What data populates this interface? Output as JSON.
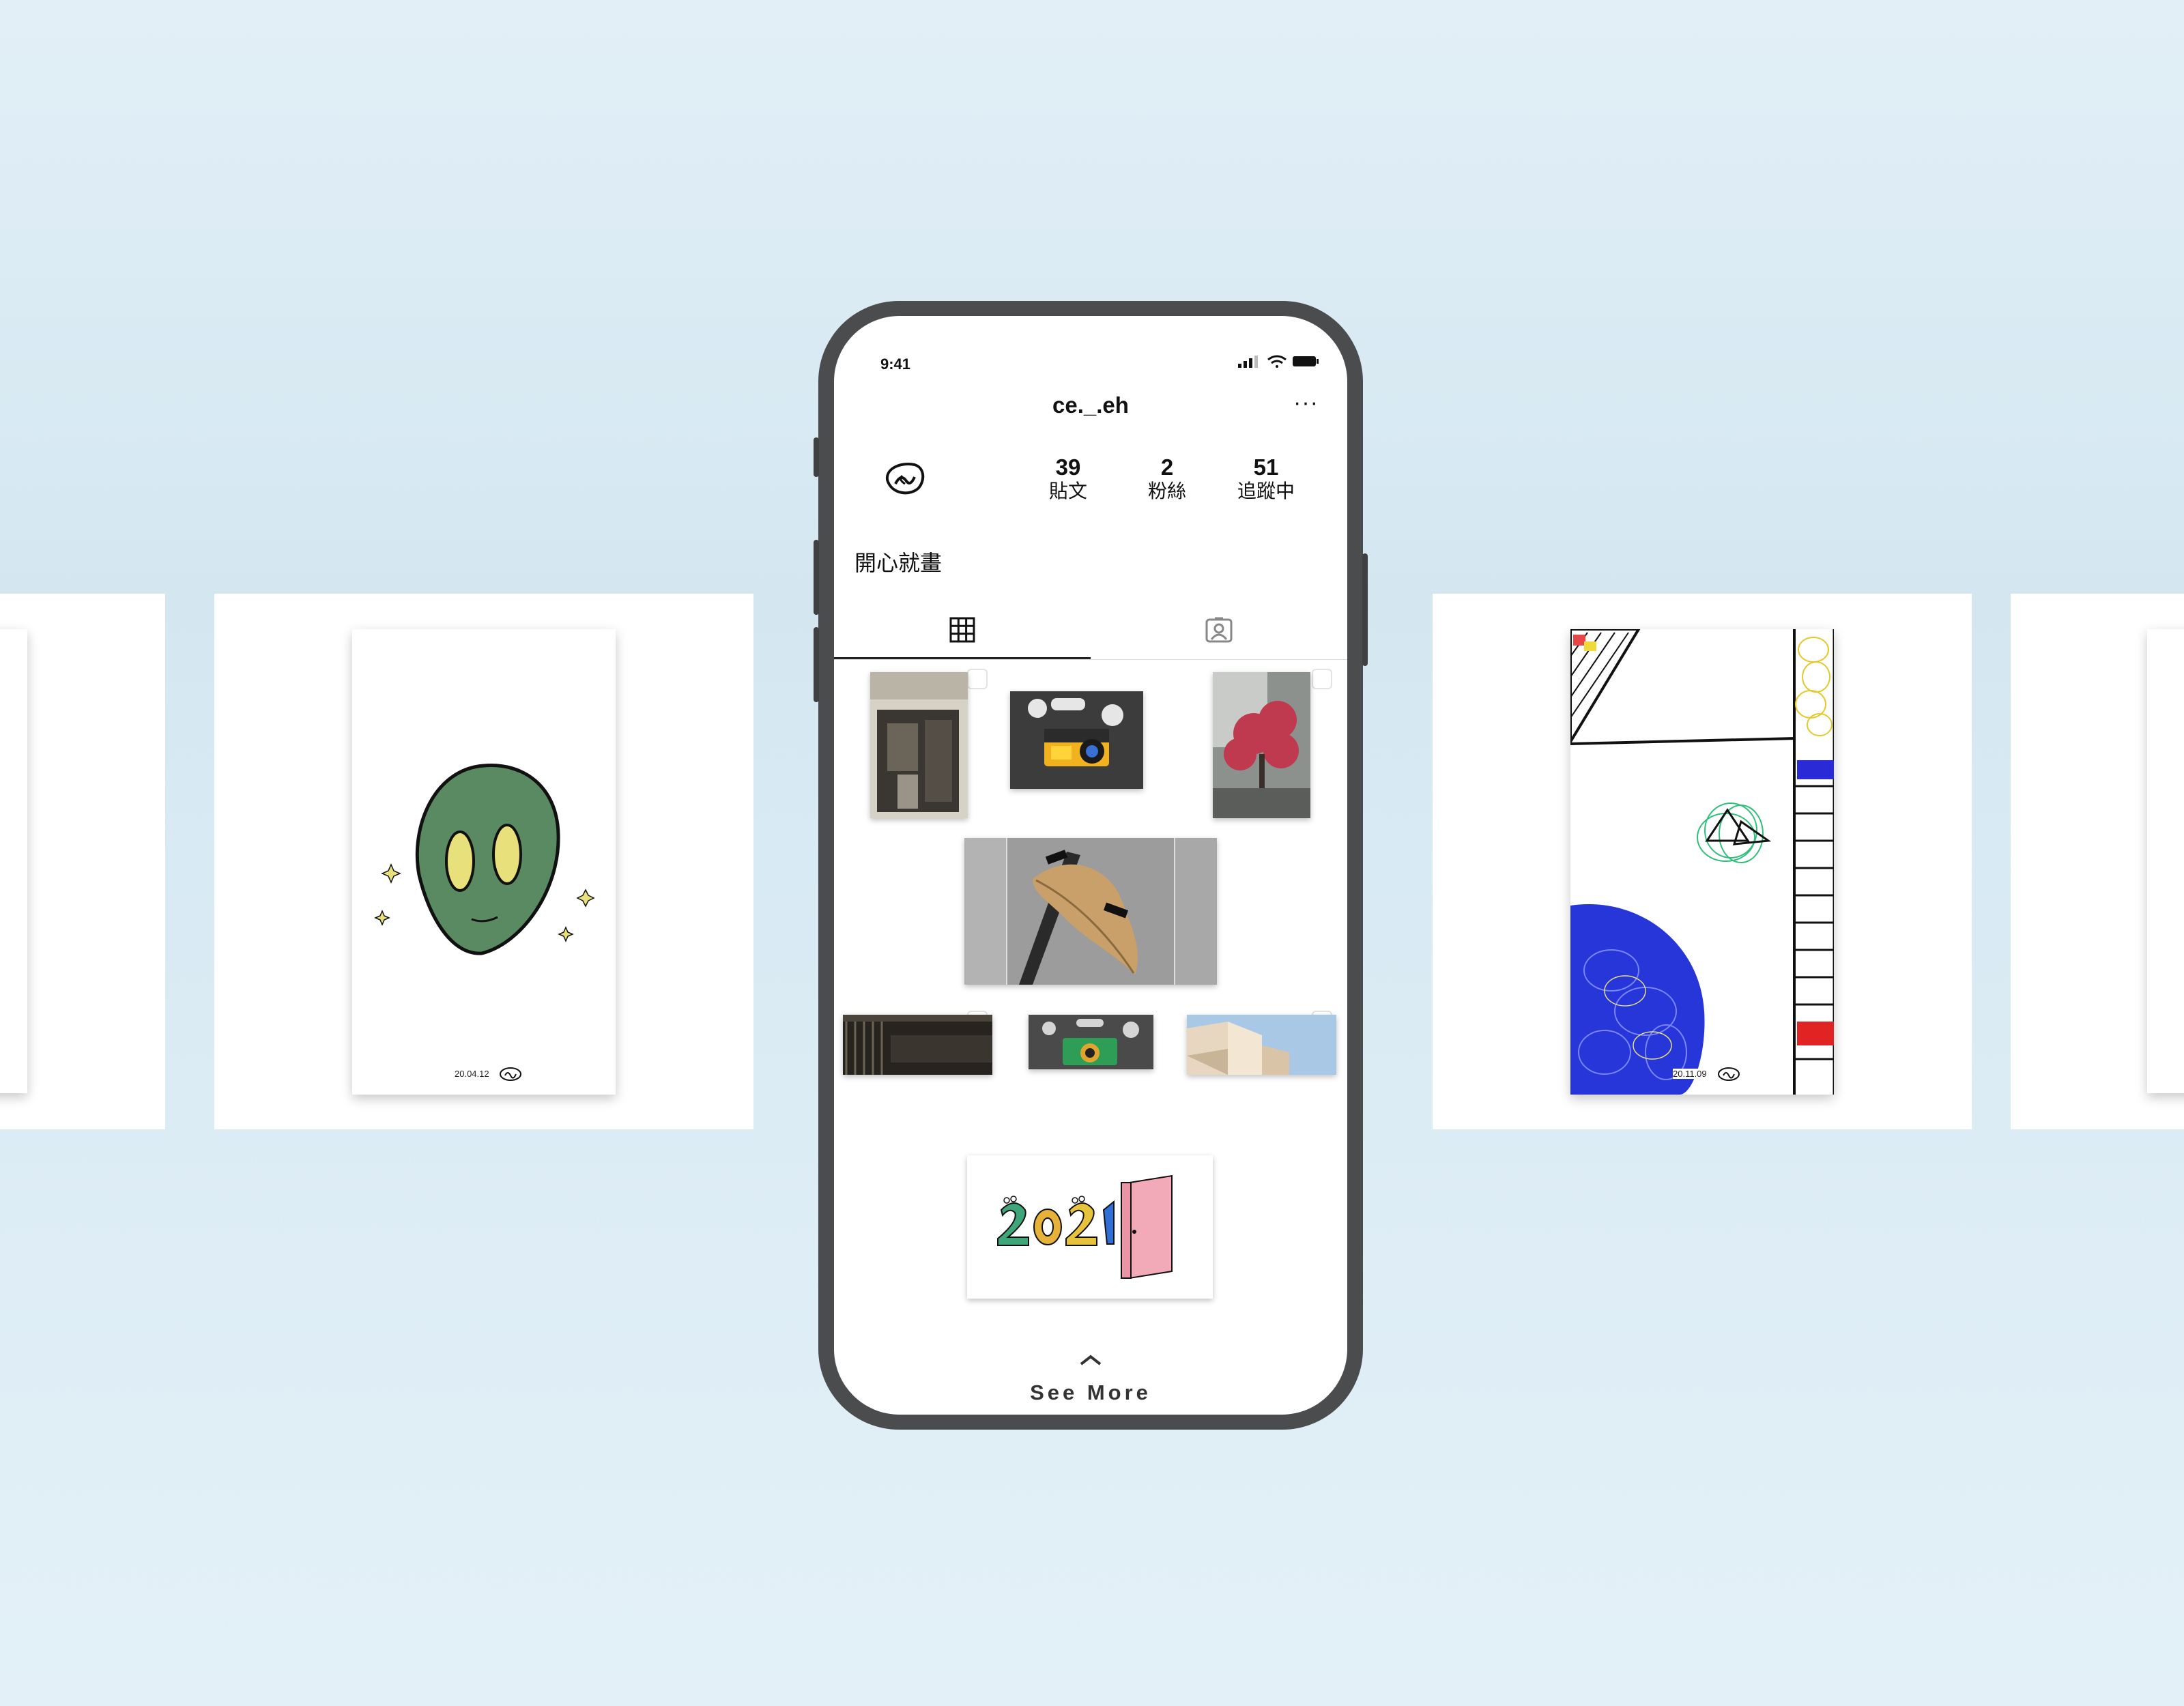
{
  "phone": {
    "status_time": "9:41",
    "username": "ce._.eh",
    "more_icon": "···",
    "stats": [
      {
        "num": "39",
        "label": "貼文"
      },
      {
        "num": "2",
        "label": "粉絲"
      },
      {
        "num": "51",
        "label": "追蹤中"
      }
    ],
    "bio": "開心就畫",
    "tabs": [
      {
        "icon": "grid-icon",
        "active": true
      },
      {
        "icon": "tagged-icon",
        "active": false
      }
    ],
    "see_more": "See More"
  },
  "posters": {
    "left_date": "20.04.12",
    "right_date": "20.11.09"
  },
  "colors": {
    "background": "#d8eaf3",
    "phone_frame": "#4b4c4e",
    "alien_green": "#5a8a62",
    "alien_eye": "#e8e07a"
  }
}
